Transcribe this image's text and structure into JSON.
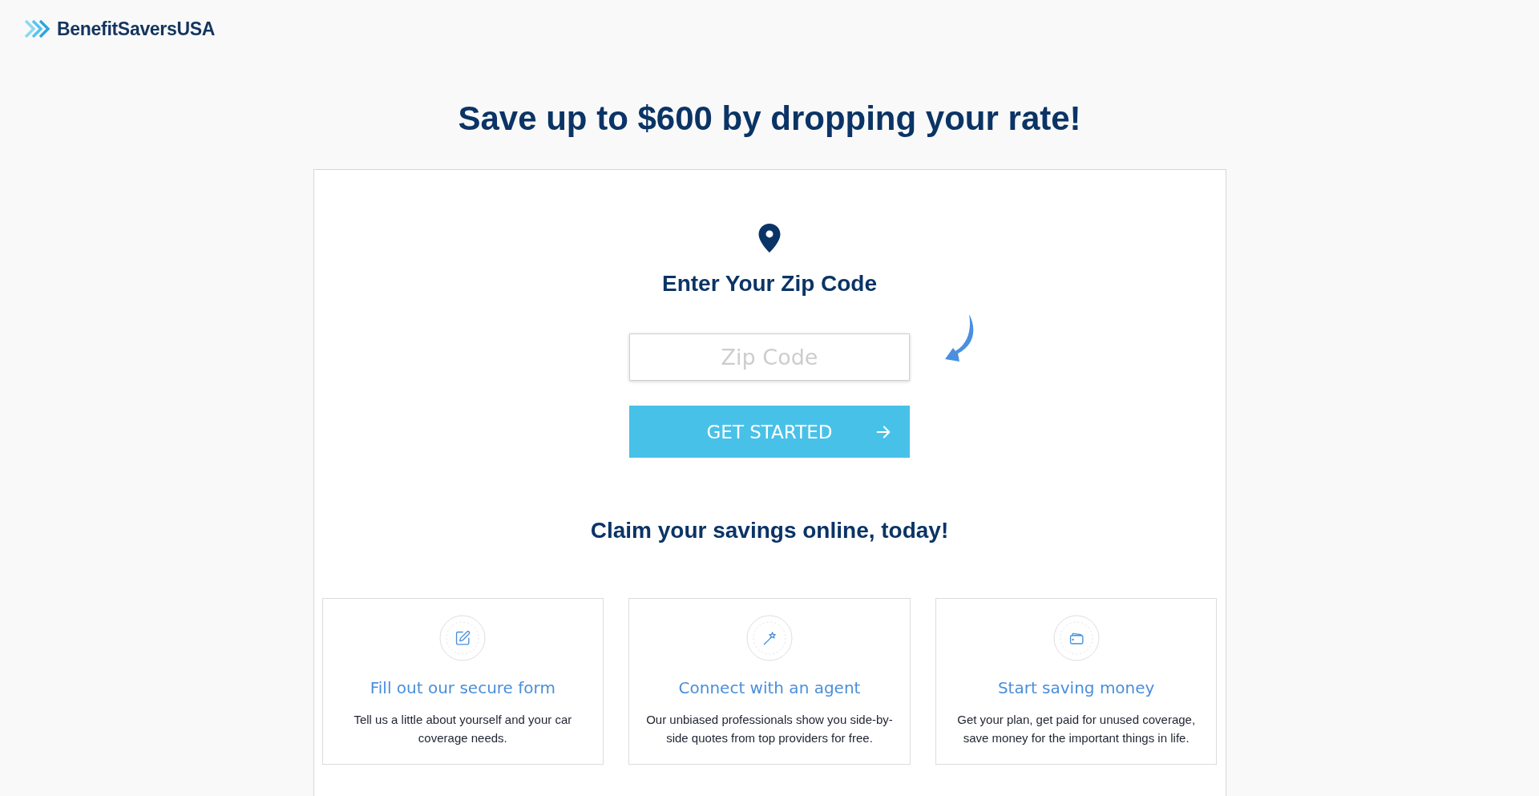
{
  "header": {
    "logo": "BenefitSaversUSA"
  },
  "headline": "Save up to $600 by dropping your rate!",
  "zip_form": {
    "title": "Enter Your Zip Code",
    "zip_field": {
      "placeholder": "Zip Code"
    },
    "submit_button": "GET STARTED"
  },
  "subheading": "Claim your savings online, today!",
  "steps": [
    {
      "kind": "form",
      "title": "Fill out our secure form",
      "text": "Tell us a little about yourself and your car coverage needs."
    },
    {
      "kind": "agent",
      "title": "Connect with an agent",
      "text": "Our unbiased professionals show you side-by-side quotes from top providers for free."
    },
    {
      "kind": "savings",
      "title": "Start saving money",
      "text": "Get your plan, get paid for unused coverage, save money for the important things in life."
    }
  ]
}
